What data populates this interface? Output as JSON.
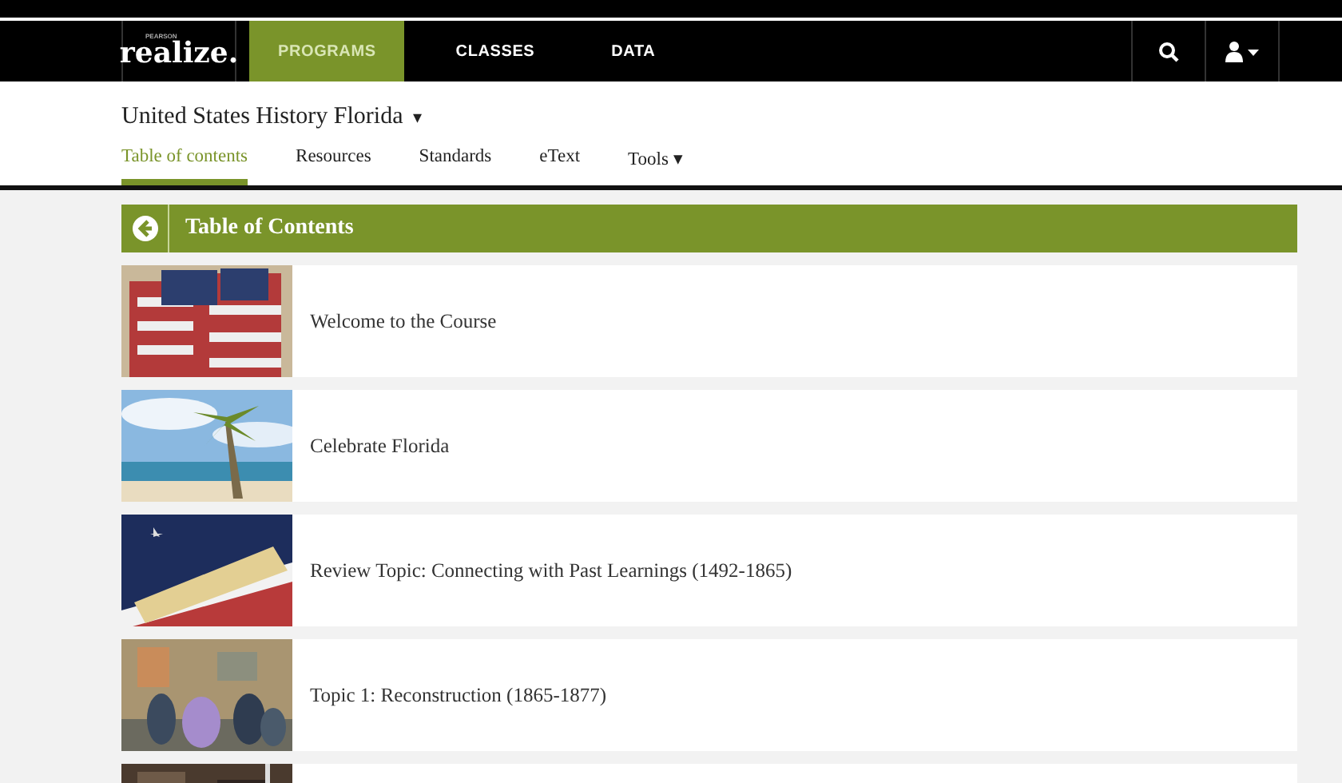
{
  "navbar": {
    "logo": "realize.",
    "logo_small": "PEARSON",
    "items": [
      {
        "label": "PROGRAMS",
        "selected": true
      },
      {
        "label": "CLASSES",
        "selected": false
      },
      {
        "label": "DATA",
        "selected": false
      }
    ]
  },
  "program": {
    "title": "United States History Florida",
    "caret": "▾"
  },
  "tabs": [
    {
      "label": "Table of contents",
      "selected": true
    },
    {
      "label": "Resources",
      "selected": false
    },
    {
      "label": "Standards",
      "selected": false
    },
    {
      "label": "eText",
      "selected": false
    },
    {
      "label": "Tools",
      "selected": false,
      "caret": "▾"
    }
  ],
  "toc": {
    "title": "Table of Contents",
    "items": [
      {
        "kind": "topic",
        "title": "Welcome to the Course"
      },
      {
        "kind": "topic",
        "title": "Celebrate Florida"
      },
      {
        "kind": "topic",
        "title": "Review Topic: Connecting with Past Learnings (1492-1865)"
      },
      {
        "kind": "topic",
        "title": "Topic 1: Reconstruction (1865-1877)"
      },
      {
        "kind": "partial"
      }
    ]
  }
}
